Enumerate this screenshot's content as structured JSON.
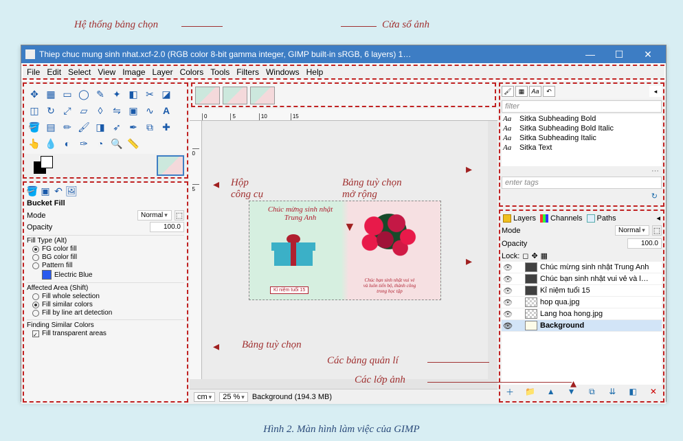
{
  "annotations": {
    "menu_system": "Hệ thống bảng chọn",
    "image_window": "Cửa sổ ảnh",
    "toolbox": "Hộp\ncông cụ",
    "dock_panel": "Bảng tuỳ chọn\nmở rộng",
    "tool_options": "Bảng tuỳ chọn",
    "management_panels": "Các bảng quản lí",
    "image_layers": "Các lớp ảnh"
  },
  "window": {
    "title": "Thiep chuc mung sinh nhat.xcf-2.0 (RGB color 8-bit gamma integer, GIMP built-in sRGB, 6 layers) 1…",
    "minimize": "—",
    "maximize": "☐",
    "close": "✕"
  },
  "menu": [
    "File",
    "Edit",
    "Select",
    "View",
    "Image",
    "Layer",
    "Colors",
    "Tools",
    "Filters",
    "Windows",
    "Help"
  ],
  "toolbox_title": "Bucket Fill",
  "tool_options": {
    "mode_label": "Mode",
    "mode_value": "Normal",
    "opacity_label": "Opacity",
    "opacity_value": "100.0",
    "fill_type_header": "Fill Type (Alt)",
    "fg_fill": "FG color fill",
    "bg_fill": "BG color fill",
    "pattern_fill": "Pattern fill",
    "pattern_name": "Electric Blue",
    "affected_area_header": "Affected Area (Shift)",
    "fill_whole": "Fill whole selection",
    "fill_similar": "Fill similar colors",
    "fill_lineart": "Fill by line art detection",
    "finding_header": "Finding Similar Colors",
    "fill_transparent": "Fill transparent areas"
  },
  "ruler_top": [
    "0",
    "5",
    "10",
    "15"
  ],
  "ruler_left": [
    "0",
    "5"
  ],
  "card": {
    "title": "Chúc mừng sinh nhật\nTrung Anh",
    "tag": "Kỉ niệm tuổi 15",
    "wish": "Chúc bạn sinh nhật vui vẻ\nvà luôn tiến bộ, thành công\ntrong học tập"
  },
  "status": {
    "unit": "cm",
    "zoom": "25 %",
    "layer_info": "Background (194.3 MB)"
  },
  "fonts": {
    "filter": "filter",
    "list": [
      "Sitka Subheading Bold",
      "Sitka Subheading Bold Italic",
      "Sitka Subheading Italic",
      "Sitka Text"
    ],
    "tags": "enter tags"
  },
  "lcp": {
    "tabs": {
      "layers": "Layers",
      "channels": "Channels",
      "paths": "Paths"
    },
    "mode_label": "Mode",
    "mode_value": "Normal",
    "opacity_label": "Opacity",
    "opacity_value": "100.0",
    "lock_label": "Lock:",
    "layers": [
      "Chúc mừng sinh nhật Trung Anh",
      "Chúc bạn sinh nhật vui vẻ và l…",
      "Kỉ niệm tuổi 15",
      "hop qua.jpg",
      "Lang hoa hong.jpg",
      "Background"
    ]
  },
  "caption": "Hình 2. Màn hình làm việc của GIMP"
}
